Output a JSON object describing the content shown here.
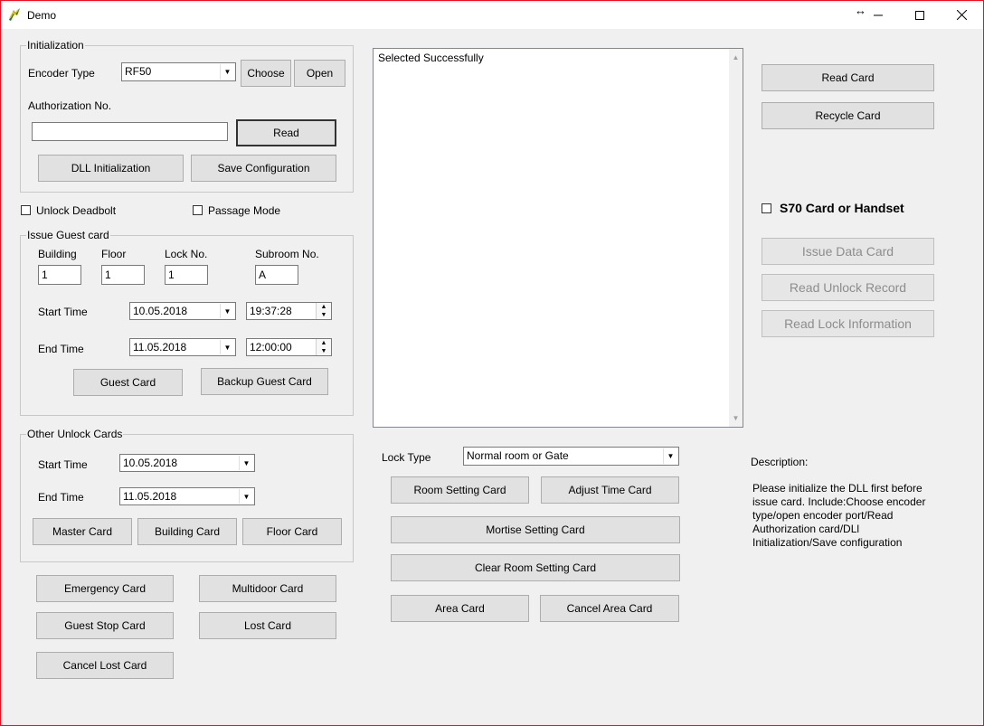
{
  "window": {
    "title": "Demo",
    "resize_glyph": "↔",
    "minimize": "—",
    "maximize": "☐",
    "close": "✕"
  },
  "init": {
    "title": "Initialization",
    "encoder_type_label": "Encoder Type",
    "encoder_type_value": "RF50",
    "choose": "Choose",
    "open": "Open",
    "auth_label": "Authorization No.",
    "auth_value": "",
    "read": "Read",
    "dll_init": "DLL Initialization",
    "save_config": "Save Configuration"
  },
  "unlock_deadbolt": "Unlock Deadbolt",
  "passage_mode": "Passage Mode",
  "guest": {
    "title": "Issue Guest card",
    "building_label": "Building",
    "floor_label": "Floor",
    "lock_label": "Lock No.",
    "subroom_label": "Subroom No.",
    "building": "1",
    "floor": "1",
    "lock": "1",
    "subroom": "A",
    "start_label": "Start Time",
    "start_date": "10.05.2018",
    "start_time": "19:37:28",
    "end_label": "End Time",
    "end_date": "11.05.2018",
    "end_time": "12:00:00",
    "guest_card": "Guest Card",
    "backup_guest_card": "Backup Guest Card"
  },
  "other": {
    "title": "Other Unlock Cards",
    "start_label": "Start Time",
    "start_date": "10.05.2018",
    "end_label": "End Time",
    "end_date": "11.05.2018",
    "master": "Master Card",
    "building": "Building Card",
    "floor": "Floor Card"
  },
  "bottom": {
    "emergency": "Emergency Card",
    "multidoor": "Multidoor Card",
    "guest_stop": "Guest Stop Card",
    "lost": "Lost Card",
    "cancel_lost": "Cancel Lost Card"
  },
  "log_text": "Selected Successfully",
  "lock": {
    "type_label": "Lock Type",
    "type_value": "Normal room or Gate",
    "room_setting": "Room Setting Card",
    "adjust_time": "Adjust Time Card",
    "mortise": "Mortise Setting Card",
    "clear_room": "Clear Room Setting Card",
    "area": "Area Card",
    "cancel_area": "Cancel Area Card"
  },
  "right": {
    "read_card": "Read Card",
    "recycle_card": "Recycle Card",
    "s70": "S70 Card or Handset",
    "issue_data": "Issue Data Card",
    "read_unlock": "Read Unlock Record",
    "read_lock_info": "Read Lock Information",
    "description_label": "Description:",
    "description_text": "Please initialize the DLL first before issue card. Include:Choose encoder type/open encoder port/Read Authorization card/DLl Initialization/Save configuration"
  }
}
